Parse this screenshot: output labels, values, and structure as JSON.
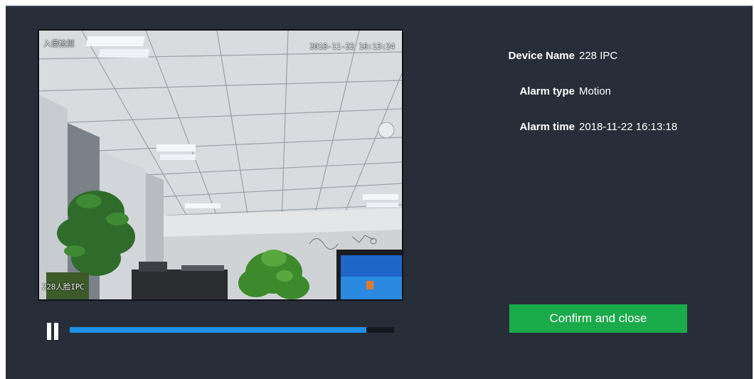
{
  "player": {
    "osd_top_left": "入侵检测",
    "osd_timestamp": "2018-11-22 16:13:24",
    "osd_bottom_left": "228人脸IPC",
    "progress": 0.915,
    "state": "playing"
  },
  "info": {
    "device_name_label": "Device Name",
    "device_name_value": "228 IPC",
    "alarm_type_label": "Alarm type",
    "alarm_type_value": "Motion",
    "alarm_time_label": "Alarm time",
    "alarm_time_value": "2018-11-22 16:13:18"
  },
  "actions": {
    "confirm_label": "Confirm and close"
  },
  "colors": {
    "dialog_bg": "#272e39",
    "progress_fill": "#1e90e6",
    "progress_track": "#14181f",
    "confirm_bg": "#1aaa4a"
  }
}
